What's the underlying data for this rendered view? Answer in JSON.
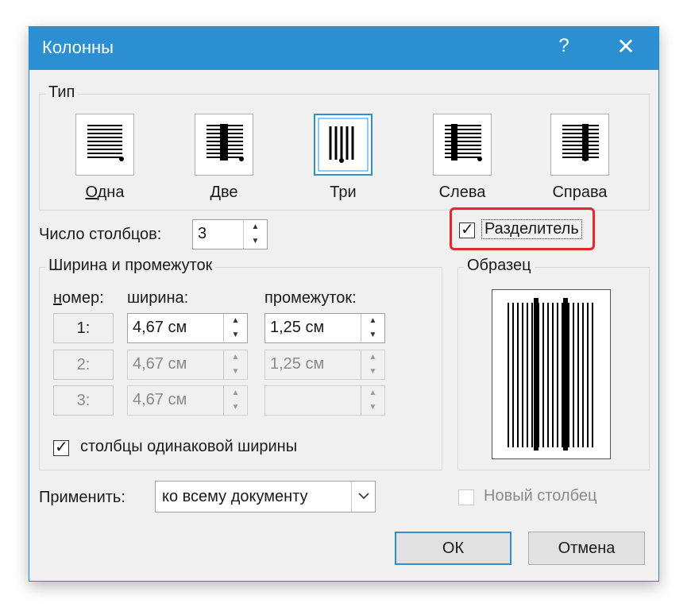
{
  "window": {
    "title": "Колонны",
    "help_glyph": "?",
    "close_glyph": "✕"
  },
  "type_group": {
    "label": "Тип",
    "presets": [
      {
        "id": "one",
        "label": "Одна"
      },
      {
        "id": "two",
        "label": "Две"
      },
      {
        "id": "three",
        "label": "Три",
        "selected": true
      },
      {
        "id": "left",
        "label": "Слева"
      },
      {
        "id": "right",
        "label": "Справа"
      }
    ]
  },
  "columns_count": {
    "label": "Число столбцов:",
    "value": "3"
  },
  "separator": {
    "label": "Разделитель",
    "checked": true,
    "highlight_color": "#e0282e"
  },
  "width_group": {
    "label": "Ширина и промежуток",
    "headers": {
      "number": "номер:",
      "width": "ширина:",
      "spacing": "промежуток:"
    },
    "rows": [
      {
        "num": "1:",
        "width": "4,67 см",
        "spacing": "1,25 см",
        "enabled": true
      },
      {
        "num": "2:",
        "width": "4,67 см",
        "spacing": "1,25 см",
        "enabled": false
      },
      {
        "num": "3:",
        "width": "4,67 см",
        "spacing": "",
        "enabled": false
      }
    ],
    "equal_width": {
      "label": "столбцы одинаковой ширины",
      "checked": true
    }
  },
  "preview": {
    "label": "Образец"
  },
  "apply": {
    "label": "Применить:",
    "value": "ко всему документу"
  },
  "new_column": {
    "label": "Новый столбец",
    "checked": false
  },
  "buttons": {
    "ok": "ОК",
    "cancel": "Отмена"
  },
  "colors": {
    "accent": "#2b8fd1",
    "dialog_bg": "#f0f0f0"
  },
  "icons": {
    "checkbox": "check-icon",
    "spinner_up": "▲",
    "spinner_down": "▼",
    "dropdown": "chevron-down-icon"
  }
}
